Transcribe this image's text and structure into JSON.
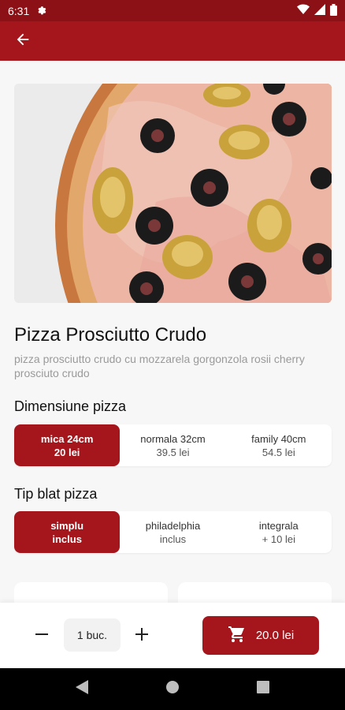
{
  "status_bar": {
    "time": "6:31"
  },
  "product": {
    "title": "Pizza Prosciutto Crudo",
    "description": "pizza prosciutto crudo cu mozzarela gorgonzola rosii cherry prosciuto crudo"
  },
  "size_section": {
    "label": "Dimensiune pizza",
    "options": [
      {
        "name": "mica 24cm",
        "price": "20 lei",
        "selected": true
      },
      {
        "name": "normala 32cm",
        "price": "39.5 lei",
        "selected": false
      },
      {
        "name": "family 40cm",
        "price": "54.5 lei",
        "selected": false
      }
    ]
  },
  "crust_section": {
    "label": "Tip blat pizza",
    "options": [
      {
        "name": "simplu",
        "price": "inclus",
        "selected": true
      },
      {
        "name": "philadelphia",
        "price": "inclus",
        "selected": false
      },
      {
        "name": "integrala",
        "price": "+ 10 lei",
        "selected": false
      }
    ]
  },
  "order_bar": {
    "quantity": "1 buc.",
    "total": "20.0 lei"
  },
  "colors": {
    "brand": "#a5161c",
    "status_bar": "#8c1116"
  }
}
